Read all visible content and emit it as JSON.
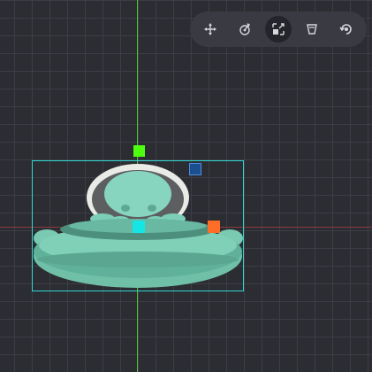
{
  "colors": {
    "background": "#2c2d33",
    "grid_line": "#3d3e45",
    "y_axis": "#4fc43a",
    "x_axis": "#8a3c3c",
    "toolbar_bg": "#3a3b42",
    "toolbar_active_bg": "#24252b",
    "toolbar_icon": "#d6d7dc",
    "selection_box": "#2fd6d2",
    "rotate_handle": "#4dff0f",
    "scale_handle": "#1c4f8f",
    "scale_handle_border": "#4d8ee0",
    "skew_handle": "#ff6d26",
    "pivot_handle": "#14e6e6"
  },
  "toolbar": {
    "tools": [
      {
        "name": "move-tool",
        "icon": "move-arrows-icon",
        "active": false
      },
      {
        "name": "rotate-tool",
        "icon": "rotate-icon",
        "active": false
      },
      {
        "name": "scale-tool",
        "icon": "scale-icon",
        "active": true
      },
      {
        "name": "skew-tool",
        "icon": "skew-icon",
        "active": false
      },
      {
        "name": "world-space-toggle",
        "icon": "world-icon",
        "active": false
      }
    ]
  },
  "selection": {
    "sprite": "alien-ufo-sprite",
    "handles": [
      "rotate-handle",
      "scale-handle",
      "skew-handle",
      "pivot-handle"
    ]
  }
}
